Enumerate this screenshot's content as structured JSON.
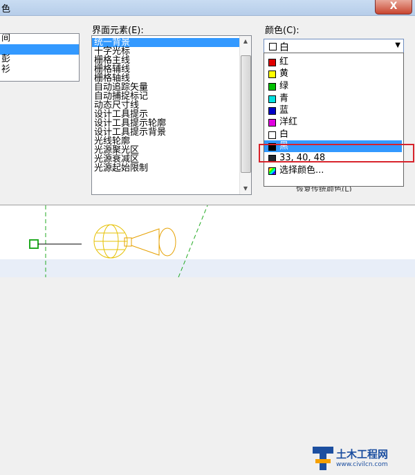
{
  "window": {
    "title": "色",
    "close_label": "X"
  },
  "context_list": {
    "items": [
      "间",
      "",
      "彭",
      "衫"
    ]
  },
  "elements": {
    "label": "界面元素(E):",
    "items": [
      "统一背景",
      "十字光标",
      "栅格主线",
      "栅格辅线",
      "栅格轴线",
      "自动追踪矢量",
      "自动捕捉标记",
      "动态尺寸线",
      "设计工具提示",
      "设计工具提示轮廓",
      "设计工具提示背景",
      "光线轮廓",
      "光源聚光区",
      "光源衰减区",
      "光源起始限制"
    ],
    "selected_index": 0
  },
  "color": {
    "label": "颜色(C):",
    "selected": {
      "label": "白",
      "swatch": "#ffffff"
    },
    "options": [
      {
        "label": "红",
        "swatch": "#e00000"
      },
      {
        "label": "黄",
        "swatch": "#ffff00"
      },
      {
        "label": "绿",
        "swatch": "#00c000"
      },
      {
        "label": "青",
        "swatch": "#00e0e0"
      },
      {
        "label": "蓝",
        "swatch": "#0000c8"
      },
      {
        "label": "洋红",
        "swatch": "#e000e0"
      },
      {
        "label": "白",
        "swatch": "#ffffff"
      },
      {
        "label": "黑",
        "swatch": "#000000"
      },
      {
        "label": "33, 40, 48",
        "swatch": "#212830"
      },
      {
        "label": "选择颜色...",
        "swatch": "multicolor-icon"
      }
    ],
    "highlighted_index": 7
  },
  "restore_button": {
    "label": "恢复传统颜色(L)"
  },
  "watermark": {
    "title": "土木工程网",
    "url": "www.civilcn.com"
  },
  "accent_colors": {
    "selection": "#3399ff",
    "highlight_box": "#d8222a"
  }
}
